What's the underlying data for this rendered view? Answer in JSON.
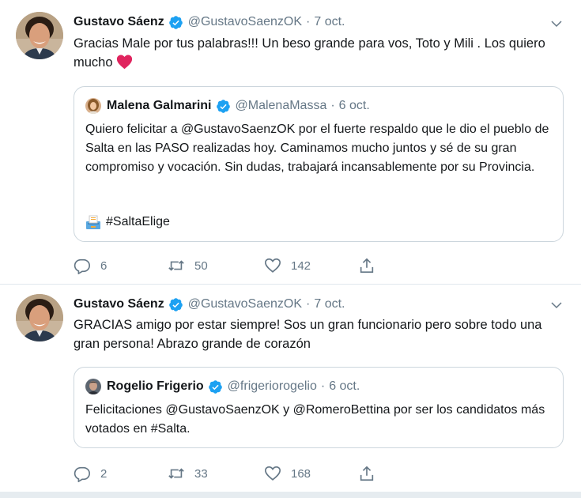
{
  "tweets": [
    {
      "author": "Gustavo Sáenz",
      "handle": "@GustavoSaenzOK",
      "separator": "·",
      "date": "7 oct.",
      "text": "Gracias Male por tus palabras!!! Un beso grande para vos, Toto y Mili . Los quiero mucho",
      "emoji": "red-heart",
      "quote": {
        "author": "Malena Galmarini",
        "handle": "@MalenaMassa",
        "separator": "·",
        "date": "6 oct.",
        "text": "Quiero felicitar a @GustavoSaenzOK por el fuerte respaldo que le dio el pueblo de Salta en las PASO realizadas hoy. Caminamos mucho juntos y sé de su gran compromiso y vocación. Sin dudas, trabajará incansablemente por su Provincia.",
        "hashtag": "#SaltaElige",
        "hashtag_emoji": "ballot-box"
      },
      "stats": {
        "replies": "6",
        "retweets": "50",
        "likes": "142"
      }
    },
    {
      "author": "Gustavo Sáenz",
      "handle": "@GustavoSaenzOK",
      "separator": "·",
      "date": "7 oct.",
      "text": "GRACIAS amigo por estar siempre! Sos un gran funcionario pero sobre todo una gran persona! Abrazo grande de corazón",
      "quote": {
        "author": "Rogelio Frigerio",
        "handle": "@frigeriorogelio",
        "separator": "·",
        "date": "6 oct.",
        "text": "Felicitaciones @GustavoSaenzOK y @RomeroBettina por ser los candidatos más votados en #Salta."
      },
      "stats": {
        "replies": "2",
        "retweets": "33",
        "likes": "168"
      }
    }
  ],
  "colors": {
    "text": "#14171a",
    "secondary": "#657786",
    "verified": "#1da1f2",
    "border": "#e1e8ed",
    "heart": "#e0245e"
  }
}
